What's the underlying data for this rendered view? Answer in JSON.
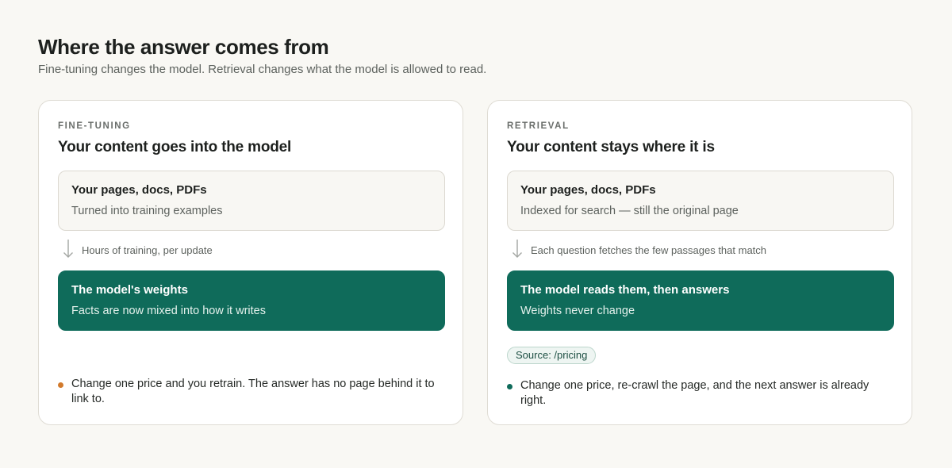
{
  "header": {
    "title": "Where the answer comes from",
    "subtitle": "Fine-tuning changes the model. Retrieval changes what the model is allowed to read."
  },
  "colors": {
    "accent_green": "#0f6b5a",
    "warning_orange": "#d27a2c",
    "background": "#f9f8f4"
  },
  "fine_tuning": {
    "eyebrow": "FINE-TUNING",
    "title": "Your content goes into the model",
    "source_box": {
      "title": "Your pages, docs, PDFs",
      "desc": "Turned into training examples"
    },
    "arrow_label": "Hours of training, per update",
    "model_box": {
      "title": "The model's weights",
      "desc": "Facts are now mixed into how it writes"
    },
    "note": "Change one price and you retrain. The answer has no page behind it to link to."
  },
  "retrieval": {
    "eyebrow": "RETRIEVAL",
    "title": "Your content stays where it is",
    "source_box": {
      "title": "Your pages, docs, PDFs",
      "desc": "Indexed for search — still the original page"
    },
    "arrow_label": "Each question fetches the few passages that match",
    "model_box": {
      "title": "The model reads them, then answers",
      "desc": "Weights never change"
    },
    "chip": "Source: /pricing",
    "note": "Change one price, re-crawl the page, and the next answer is already right."
  }
}
